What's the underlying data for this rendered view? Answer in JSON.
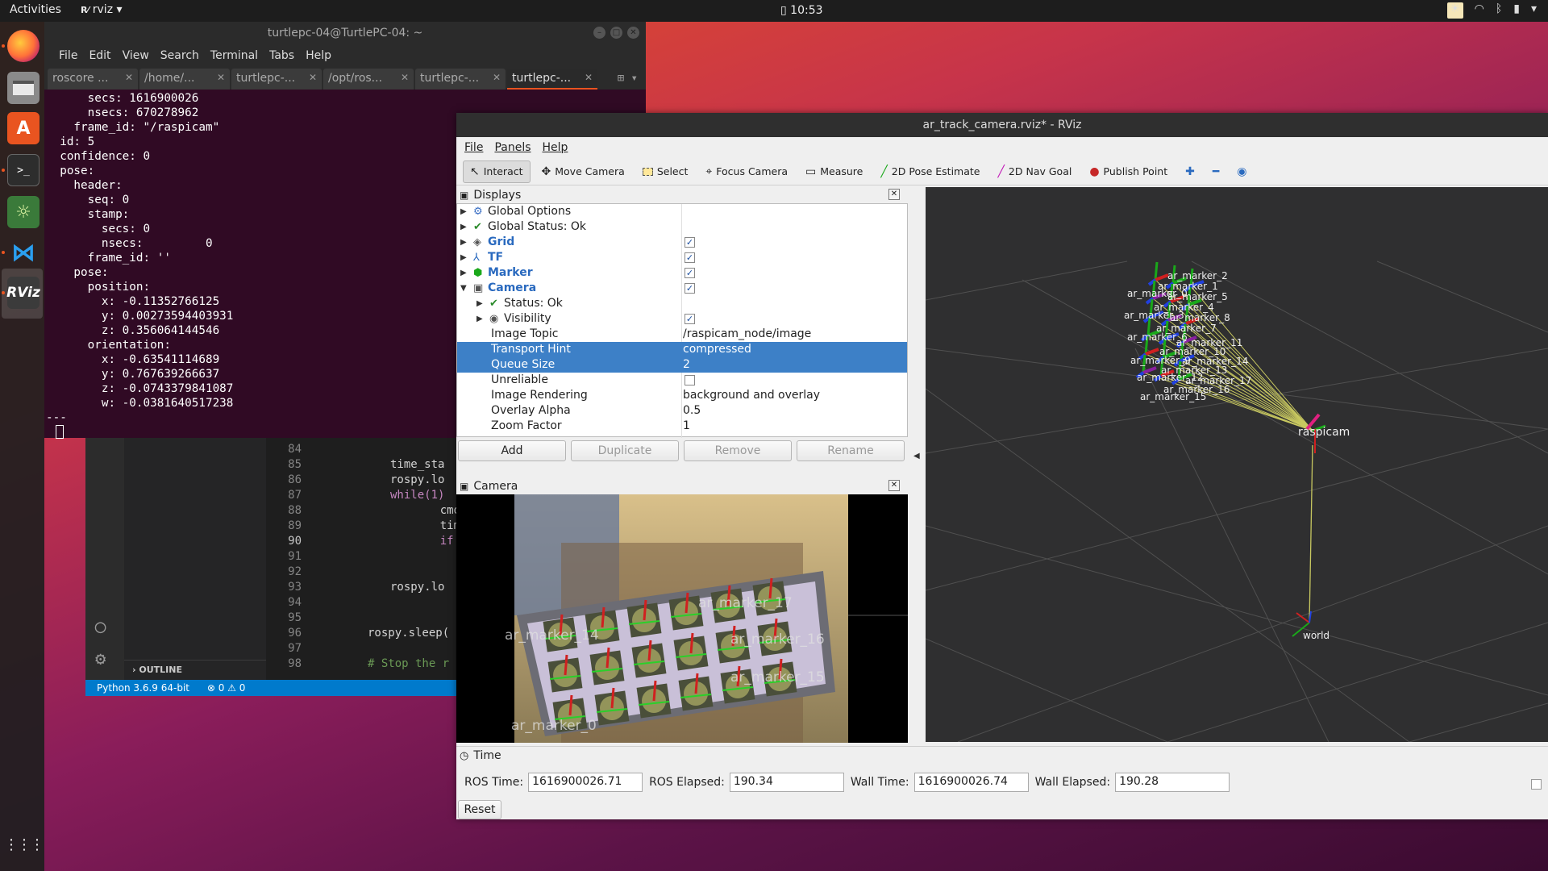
{
  "topbar": {
    "activities": "Activities",
    "app_name": "rviz",
    "app_menu_arrow": "▾",
    "clock": "10:53",
    "tray_icons": [
      "weather-icon",
      "wifi-icon",
      "bluetooth-icon",
      "battery-icon",
      "power-menu-icon"
    ]
  },
  "dock": {
    "apps": [
      "firefox",
      "files",
      "software-center",
      "terminal",
      "settings",
      "vscode",
      "rviz"
    ],
    "rviz_label": "RViz",
    "grid_icon": "⋮⋮⋮"
  },
  "terminal": {
    "title": "turtlepc-04@TurtlePC-04: ~",
    "menu": [
      "File",
      "Edit",
      "View",
      "Search",
      "Terminal",
      "Tabs",
      "Help"
    ],
    "tabs": [
      "roscore ...",
      "/home/...",
      "turtlepc-...",
      "/opt/ros...",
      "turtlepc-...",
      "turtlepc-..."
    ],
    "active_tab": 5,
    "lines": [
      "      secs: 1616900026",
      "      nsecs: 670278962",
      "    frame_id: \"/raspicam\"",
      "  id: 5",
      "  confidence: 0",
      "  pose:",
      "    header:",
      "      seq: 0",
      "      stamp:",
      "        secs: 0",
      "        nsecs:         0",
      "      frame_id: ''",
      "    pose:",
      "      position:",
      "        x: -0.11352766125",
      "        y: 0.00273594403931",
      "        z: 0.356064144546",
      "      orientation:",
      "        x: -0.63541114689",
      "        y: 0.767639266637",
      "        z: -0.0743379841087",
      "        w: -0.0381640517238",
      "---"
    ]
  },
  "vscode": {
    "line_numbers": [
      "84",
      "85",
      "86",
      "87",
      "88",
      "89",
      "90",
      "91",
      "92",
      "93",
      "94",
      "95",
      "96",
      "97",
      "98"
    ],
    "code_lines": [
      "",
      "time_sta",
      "rospy.lo",
      "while(1)",
      "    cmd_",
      "    time",
      "    if (",
      "        ",
      "",
      "rospy.lo",
      "",
      "",
      "rospy.sleep(",
      "",
      "# Stop the r"
    ],
    "outline": "OUTLINE",
    "status_python": "Python 3.6.9 64-bit",
    "status_problems": "⊗ 0 ⚠ 0"
  },
  "rviz": {
    "title": "ar_track_camera.rviz* - RViz",
    "menu": [
      "File",
      "Panels",
      "Help"
    ],
    "toolbar": [
      {
        "label": "Interact",
        "icon": "↖",
        "active": true
      },
      {
        "label": "Move Camera",
        "icon": "✥"
      },
      {
        "label": "Select",
        "icon": "▭"
      },
      {
        "label": "Focus Camera",
        "icon": "⌖"
      },
      {
        "label": "Measure",
        "icon": "━"
      },
      {
        "label": "2D Pose Estimate",
        "icon": "╱",
        "color": "#1aa81a"
      },
      {
        "label": "2D Nav Goal",
        "icon": "╱",
        "color": "#c21ab8"
      },
      {
        "label": "Publish Point",
        "icon": "●",
        "color": "#c62828"
      }
    ],
    "displays": {
      "title": "Displays",
      "rows": [
        {
          "label": "Global Options",
          "value": ""
        },
        {
          "label": "Global Status: Ok",
          "value": ""
        },
        {
          "label": "Grid",
          "value": "✓"
        },
        {
          "label": "TF",
          "value": "✓"
        },
        {
          "label": "Marker",
          "value": "✓"
        },
        {
          "label": "Camera",
          "value": "✓"
        },
        {
          "label": "Status: Ok",
          "value": ""
        },
        {
          "label": "Visibility",
          "value": "✓"
        },
        {
          "label": "Image Topic",
          "value": "/raspicam_node/image"
        },
        {
          "label": "Transport Hint",
          "value": "compressed"
        },
        {
          "label": "Queue Size",
          "value": "2"
        },
        {
          "label": "Unreliable",
          "value": ""
        },
        {
          "label": "Image Rendering",
          "value": "background and overlay"
        },
        {
          "label": "Overlay Alpha",
          "value": "0.5"
        },
        {
          "label": "Zoom Factor",
          "value": "1"
        }
      ],
      "buttons": [
        "Add",
        "Duplicate",
        "Remove",
        "Rename"
      ]
    },
    "camera_panel": {
      "title": "Camera",
      "overlay_labels": [
        "ar_marker_14",
        "ar_marker_17",
        "ar_marker_16",
        "ar_marker_15",
        "ar_marker_0"
      ]
    },
    "viewport": {
      "marker_labels": [
        "ar_marker_2",
        "ar_marker_1",
        "ar_marker_0",
        "ar_marker_5",
        "ar_marker_4",
        "ar_marker_3",
        "ar_marker_8",
        "ar_marker_7",
        "ar_marker_6",
        "ar_marker_11",
        "ar_marker_10",
        "ar_marker_9",
        "ar_marker_14",
        "ar_marker_13",
        "ar_marker_12",
        "ar_marker_17",
        "ar_marker_16",
        "ar_marker_15"
      ],
      "raspicam": "raspicam",
      "world": "world"
    },
    "time": {
      "title": "Time",
      "ros_time_label": "ROS Time:",
      "ros_time": "1616900026.71",
      "ros_elapsed_label": "ROS Elapsed:",
      "ros_elapsed": "190.34",
      "wall_time_label": "Wall Time:",
      "wall_time": "1616900026.74",
      "wall_elapsed_label": "Wall Elapsed:",
      "wall_elapsed": "190.28",
      "reset": "Reset"
    }
  }
}
